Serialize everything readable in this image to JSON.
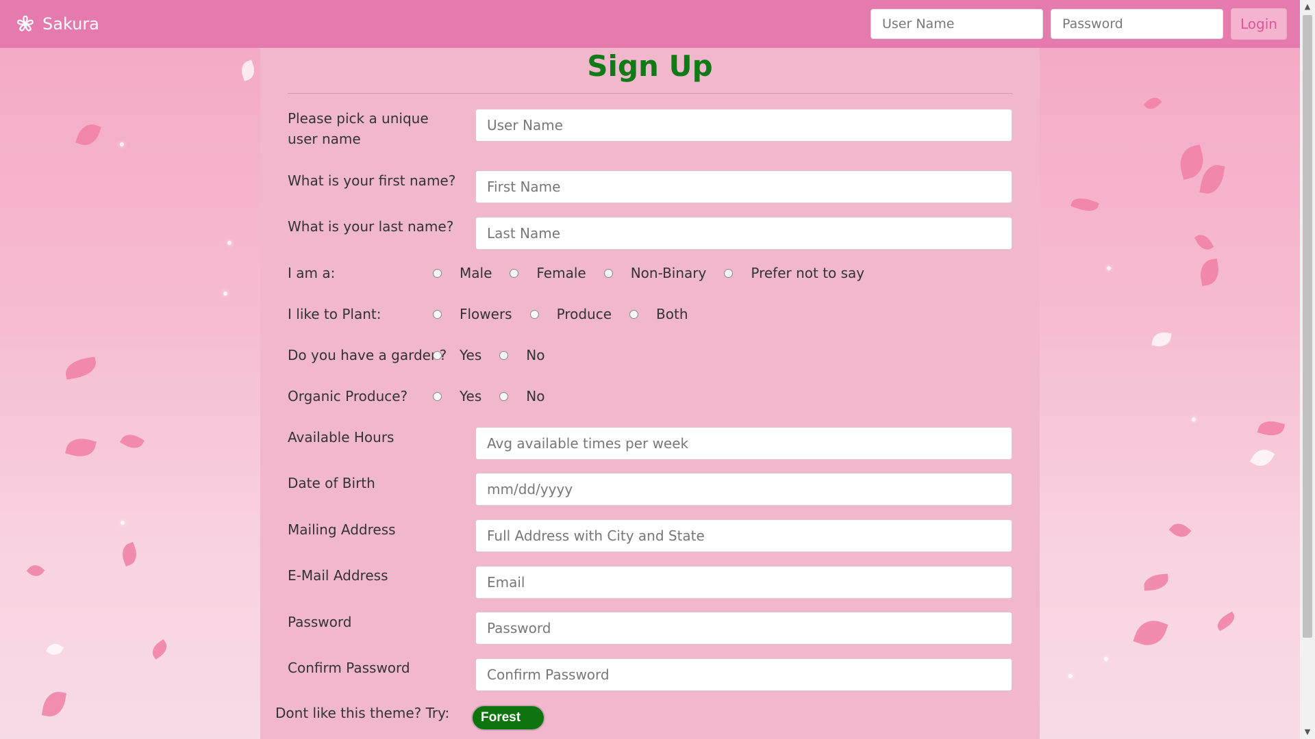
{
  "navbar": {
    "brand": "Sakura",
    "username_placeholder": "User Name",
    "password_placeholder": "Password",
    "login_label": "Login"
  },
  "form": {
    "title": "Sign Up",
    "username": {
      "label": "Please pick a unique user name",
      "placeholder": "User Name"
    },
    "first_name": {
      "label": "What is your first name?",
      "placeholder": "First Name"
    },
    "last_name": {
      "label": "What is your last name?",
      "placeholder": "Last Name"
    },
    "gender": {
      "label": "I am a:",
      "options": [
        "Male",
        "Female",
        "Non-Binary",
        "Prefer not to say"
      ]
    },
    "plant": {
      "label": "I like to Plant:",
      "options": [
        "Flowers",
        "Produce",
        "Both"
      ]
    },
    "garden": {
      "label": "Do you have a garden?",
      "options": [
        "Yes",
        "No"
      ]
    },
    "organic": {
      "label": "Organic Produce?",
      "options": [
        "Yes",
        "No"
      ]
    },
    "hours": {
      "label": "Available Hours",
      "placeholder": "Avg available times per week"
    },
    "dob": {
      "label": "Date of Birth",
      "placeholder": "mm/dd/yyyy"
    },
    "address": {
      "label": "Mailing Address",
      "placeholder": "Full Address with City and State"
    },
    "email": {
      "label": "E-Mail Address",
      "placeholder": "Email"
    },
    "password": {
      "label": "Password",
      "placeholder": "Password"
    },
    "confirm": {
      "label": "Confirm Password",
      "placeholder": "Confirm Password"
    },
    "theme_prompt": "Dont like this theme? Try:",
    "theme_button": "Forest"
  },
  "colors": {
    "navbar": "#e47aae",
    "panel": "#f0b7cd",
    "title": "#0f7a16",
    "forest_button": "#0f730f"
  }
}
